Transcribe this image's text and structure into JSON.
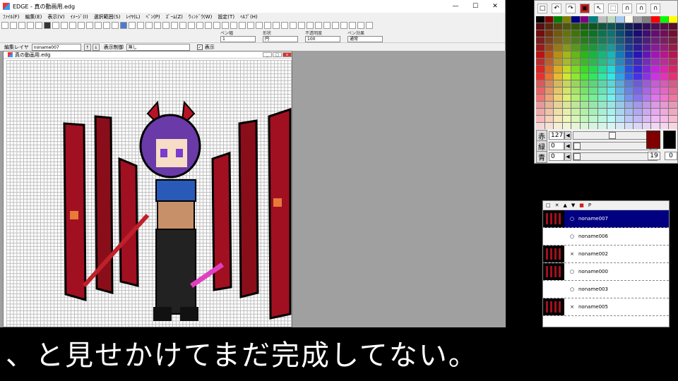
{
  "app": {
    "title": "EDGE - 真の動画用.edg",
    "menu": [
      "ﾌｧｲﾙ(F)",
      "編集(E)",
      "表示(V)",
      "ｲﾒｰｼﾞ(I)",
      "選択範囲(S)",
      "ﾚｲﾔ(L)",
      "ﾍﾟﾝ(P)",
      "ｽﾞｰﾑ(Z)",
      "ｳｨﾝﾄﾞｳ(W)",
      "設定(T)",
      "ﾍﾙﾌﾟ(H)"
    ],
    "pen_width_label": "ペン幅",
    "pen_width_value": "1",
    "shape_label": "形状",
    "shape_value": "円",
    "opacity_label": "不透明度",
    "opacity_value": "100",
    "effect_label": "ペン効果",
    "effect_value": "通常",
    "edit_layer_label": "編集レイヤ",
    "edit_layer_value": "noname007",
    "display_control_label": "表示制御",
    "display_control_value": "無し",
    "show_label": "表示",
    "show_checked": "✓"
  },
  "document": {
    "title": "真の動画用.edg"
  },
  "palette": {
    "red_label": "赤",
    "red_value": "127",
    "green_label": "緑",
    "green_value": "0",
    "blue_label": "青",
    "blue_value": "0",
    "index_value": "19",
    "index_value2": "0",
    "colors": [
      "#000000",
      "#800000",
      "#008000",
      "#808000",
      "#000080",
      "#800080",
      "#008080",
      "#c0c0c0",
      "#c0dcc0",
      "#a6caf0",
      "#fffbf0",
      "#a0a0a4",
      "#808080",
      "#ff0000",
      "#00ff00",
      "#ffff00"
    ]
  },
  "layers": {
    "items": [
      {
        "name": "noname007",
        "mark": "○",
        "active": true
      },
      {
        "name": "noname006",
        "mark": "○",
        "active": false
      },
      {
        "name": "noname002",
        "mark": "×",
        "active": false
      },
      {
        "name": "noname000",
        "mark": "○",
        "active": false
      },
      {
        "name": "noname003",
        "mark": "○",
        "active": false
      },
      {
        "name": "noname005",
        "mark": "×",
        "active": false
      }
    ]
  },
  "subtitle": "、と見せかけてまだ完成してない。"
}
